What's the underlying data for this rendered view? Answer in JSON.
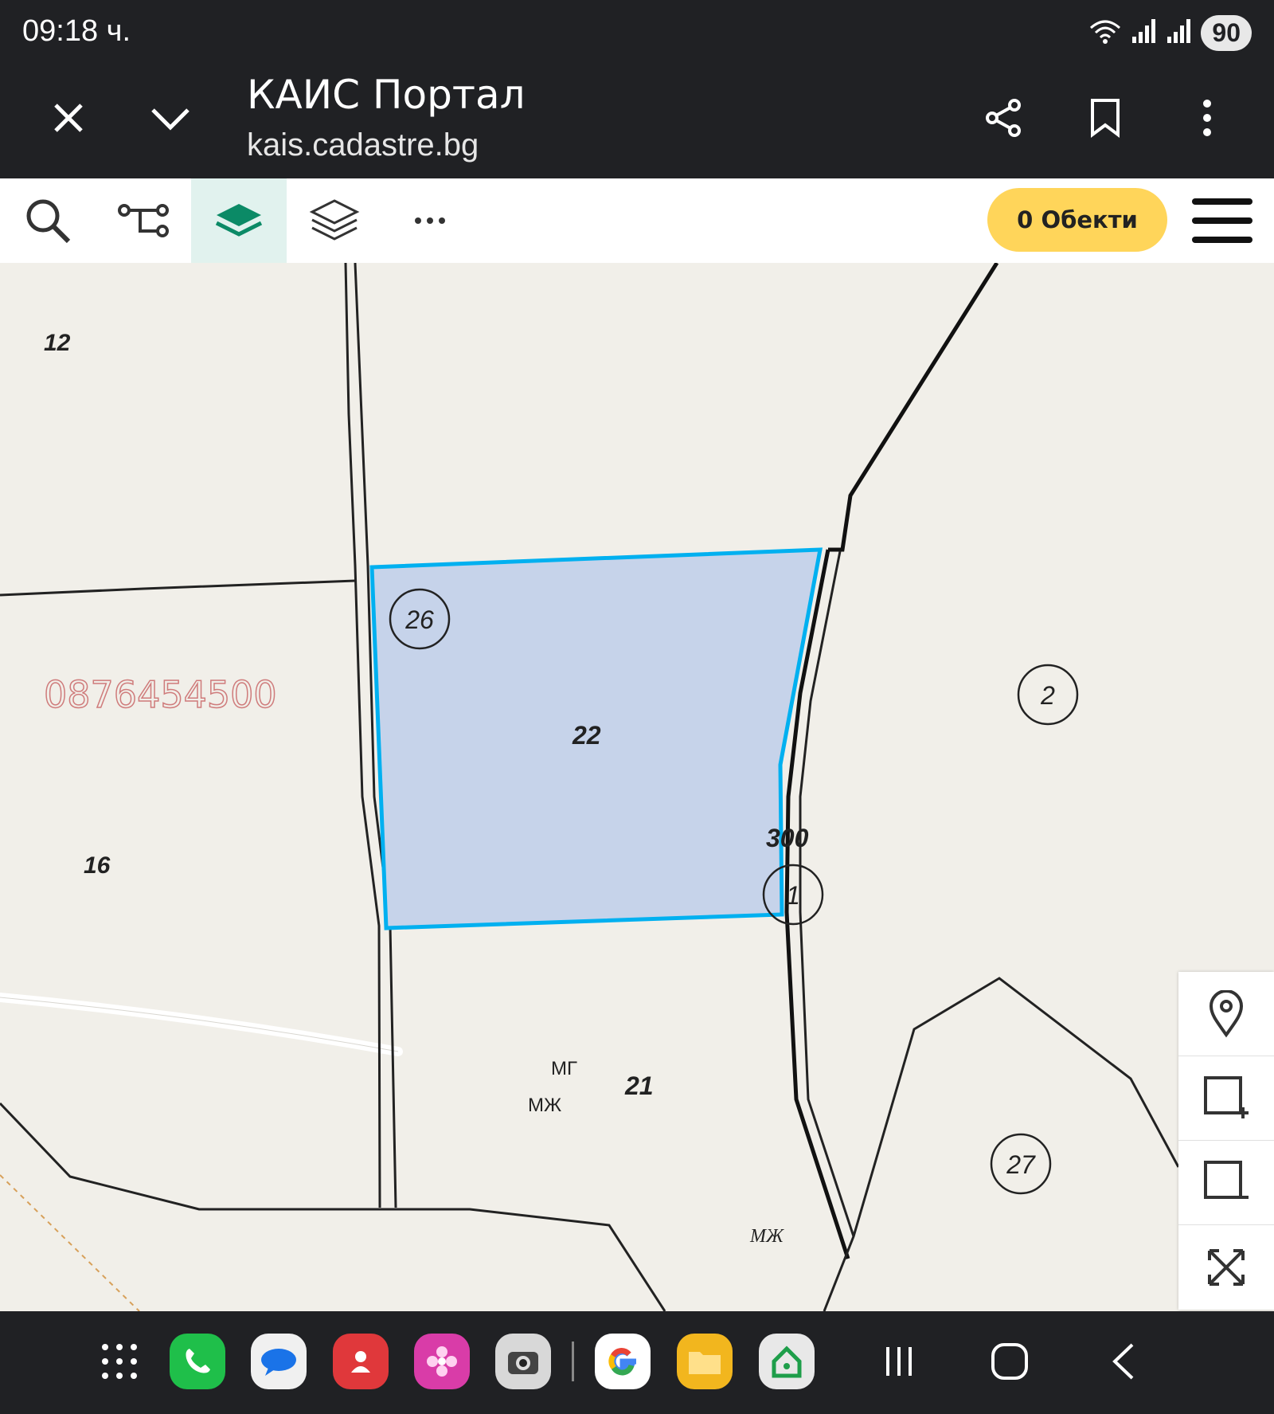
{
  "status": {
    "time": "09:18 ч.",
    "battery": "90"
  },
  "browser": {
    "title": "КАИС Портал",
    "url": "kais.cadastre.bg"
  },
  "toolbar": {
    "objects_label": "0 Обекти"
  },
  "map": {
    "labels": {
      "parcel_12": "12",
      "parcel_16": "16",
      "parcel_22": "22",
      "parcel_21": "21",
      "road_300": "300",
      "phone_watermark": "0876454500",
      "mg": "МГ",
      "mzh_1": "МЖ",
      "mzh_2": "МЖ"
    },
    "circled": {
      "c26": "26",
      "c2": "2",
      "c1": "1",
      "c27": "27"
    },
    "selection_color": "#00b0f0",
    "selection_fill": "#c6d3ea"
  },
  "colors": {
    "accent": "#ffd55a",
    "active_tool": "#0b8a66",
    "watermark": "#cf7b7b"
  }
}
